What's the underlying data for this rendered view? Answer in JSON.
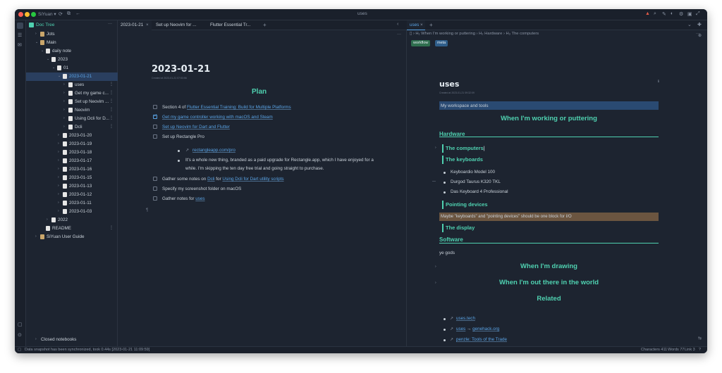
{
  "titlebar": {
    "workspace": "SiYuan ▾",
    "doc_title": "uses"
  },
  "sidebar": {
    "title": "Doc Tree",
    "closed_notebooks": "Closed notebooks",
    "items": [
      {
        "label": "Jots",
        "arrow": "›"
      },
      {
        "label": "Main",
        "arrow": "⌄"
      },
      {
        "label": "daily note",
        "arrow": "⌄"
      },
      {
        "label": "2023",
        "arrow": "⌄"
      },
      {
        "label": "01",
        "arrow": "⌄"
      },
      {
        "label": "2023-01-21",
        "arrow": "⌄"
      },
      {
        "label": "uses",
        "arrow": "›"
      },
      {
        "label": "Get my game c...",
        "arrow": "›"
      },
      {
        "label": "Set up Neovim ...",
        "arrow": "›"
      },
      {
        "label": "Neovim",
        "arrow": "›"
      },
      {
        "label": "Using Dcli for D...",
        "arrow": "›"
      },
      {
        "label": "Dcli",
        "arrow": "›"
      },
      {
        "label": "2023-01-20",
        "arrow": "›"
      },
      {
        "label": "2023-01-19",
        "arrow": "›"
      },
      {
        "label": "2023-01-18",
        "arrow": "›"
      },
      {
        "label": "2023-01-17",
        "arrow": "›"
      },
      {
        "label": "2023-01-16",
        "arrow": "›"
      },
      {
        "label": "2023-01-15",
        "arrow": "›"
      },
      {
        "label": "2023-01-13",
        "arrow": "›"
      },
      {
        "label": "2023-01-12",
        "arrow": "›"
      },
      {
        "label": "2023-01-11",
        "arrow": "›"
      },
      {
        "label": "2023-01-03",
        "arrow": "›"
      },
      {
        "label": "2022",
        "arrow": "›"
      },
      {
        "label": "README",
        "arrow": ""
      },
      {
        "label": "SiYuan User Guide",
        "arrow": "›"
      }
    ]
  },
  "tabs_left": [
    {
      "label": "2023-01-21"
    },
    {
      "label": "Set up Neovim for ..."
    },
    {
      "label": "Flutter Essential Tr..."
    }
  ],
  "tabs_right": [
    {
      "label": "uses"
    }
  ],
  "left_doc": {
    "title": "2023-01-21",
    "meta": "Created at 2023-01-21 07:53:56",
    "heading": "Plan",
    "tasks": [
      {
        "prefix": "Section 4 of ",
        "link": "Flutter Essential Training: Build for Multiple Platforms",
        "suffix": "",
        "checked": false
      },
      {
        "prefix": "",
        "link": "Get my game controller working with macOS and Steam",
        "suffix": "",
        "checked": true
      },
      {
        "prefix": "",
        "link": "Set up Neovim for Dart and Flutter",
        "suffix": "",
        "checked": false
      },
      {
        "prefix": "Set up Rectangle Pro",
        "link": "",
        "suffix": "",
        "checked": false
      }
    ],
    "sub_link": "rectangleapp.com/pro",
    "sub_text_1": "It's a whole new thing, branded as a paid upgrade for Rectangle.app, which I have enjoyed for a",
    "sub_text_2": "while. I'm skipping the ten day free trial and going straight to purchase.",
    "tasks2": [
      {
        "prefix": "Gather some notes on ",
        "link": "Dcli",
        "mid": " for ",
        "link2": "Using Dcli for Dart utility scripts",
        "checked": false
      },
      {
        "prefix": "Specify my screenshot folder on macOS",
        "link": "",
        "mid": "",
        "link2": "",
        "checked": false
      },
      {
        "prefix": "Gather notes for ",
        "link": "uses",
        "mid": "",
        "link2": "",
        "checked": false
      }
    ],
    "para_mark": "¶"
  },
  "right_doc": {
    "breadcrumb": [
      "H₁ When I'm working or puttering",
      "H₂ Hardware",
      "H₃ The computers"
    ],
    "tags": [
      "workflow",
      "meta"
    ],
    "title": "uses",
    "meta": "Created at 2023-01-21 09:32:09",
    "intro": "My workspace and tools",
    "h1_working": "When I'm working or puttering",
    "h2_hardware": "Hardware",
    "h3_computers": "The computers",
    "h3_keyboards": "The keyboards",
    "keyboards": [
      "Keyboardio Model 100",
      "Durgod Taurus K320 TKL",
      "Das Keyboard 4 Professional"
    ],
    "h3_pointing": "Pointing devices",
    "pointing_note": "Maybe \"keyboards\" and \"pointing devices\" should be one block for I/O",
    "h3_display": "The display",
    "h2_software": "Software",
    "software_note": "ye gods",
    "h1_drawing": "When I'm drawing",
    "h1_outthere": "When I'm out there in the world",
    "h1_related": "Related",
    "related": [
      {
        "link": "uses.tech",
        "mid": "",
        "link2": ""
      },
      {
        "link": "uses",
        "mid": " → ",
        "link2": "genehack.org"
      },
      {
        "link": "penzle: Tools of the Trade",
        "mid": "",
        "link2": ""
      }
    ]
  },
  "status": {
    "left": "Data snapshot has been synchronized, took 0.44s [2023-01-21 11:09:59]",
    "characters": "Characters 411",
    "words": "Words 77",
    "links": "Link 3"
  },
  "colors": {
    "accent": "#4fd1b0",
    "link": "#5aa4e6",
    "selected": "#2a3f5f",
    "highlight_blue": "#2a4a72",
    "highlight_brown": "#6b5540"
  }
}
